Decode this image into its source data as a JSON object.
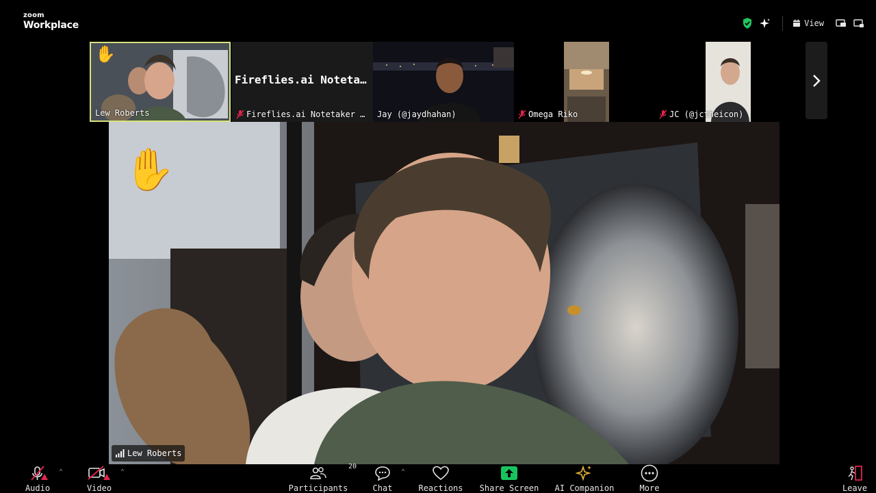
{
  "app": {
    "logo_small": "zoom",
    "logo_big": "Workplace"
  },
  "topbar": {
    "view_label": "View",
    "icons": [
      "shield-check-icon",
      "sparkle-icon",
      "calendar-grid-icon",
      "picture-in-picture-icon",
      "minimize-window-icon"
    ]
  },
  "thumbnails": [
    {
      "name": "Lew Roberts",
      "muted": false,
      "raised_hand": true,
      "active_speaker": true
    },
    {
      "name": "Fireflies.ai Notetaker …",
      "big_text": "Fireflies.ai Noteta…",
      "muted": true
    },
    {
      "name": "Jay (@jaydhahan)",
      "muted": false
    },
    {
      "name": "Omega Riko",
      "muted": true
    },
    {
      "name": "JC (@jctheicon)",
      "muted": true
    }
  ],
  "speaker": {
    "name": "Lew Roberts",
    "raised_hand": true
  },
  "toolbar": {
    "audio_label": "Audio",
    "video_label": "Video",
    "participants_label": "Participants",
    "participants_count": "20",
    "chat_label": "Chat",
    "reactions_label": "Reactions",
    "share_label": "Share Screen",
    "ai_label": "AI Companion",
    "more_label": "More",
    "leave_label": "Leave"
  },
  "colors": {
    "active_border": "#d7e37a",
    "secure_green": "#23c45e",
    "share_green": "#19c45e",
    "alert_red": "#e0244a",
    "ai_gold": "#e8b53a",
    "leave_red": "#e0244a"
  }
}
